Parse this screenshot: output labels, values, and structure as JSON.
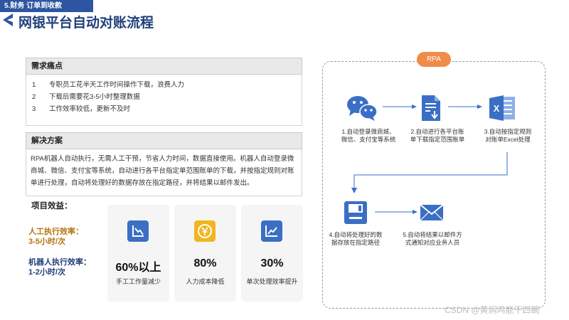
{
  "header": {
    "tag": "5.财务 订单到收款",
    "title": "网银平台自动对账流程"
  },
  "pain_points": {
    "heading": "需求痛点",
    "items": [
      {
        "num": "1",
        "text": "专职员工花半天工作时间操作下载，浪费人力"
      },
      {
        "num": "2",
        "text": "下载后需要花3-5小时整理数据"
      },
      {
        "num": "3",
        "text": "工作效率较低，更新不及时"
      }
    ]
  },
  "solution": {
    "heading": "解决方案",
    "text": "RPA机器人自动执行，无需人工干预，节省人力时间，数据直接使用。机器人自动登录微商城、微信、支付宝等系统，自动进行各平台指定单范围账单的下载，并按指定规则对账单进行处理，自动将处理好的数据存放在指定路径，并将结果以邮件发出。"
  },
  "results": {
    "title": "项目效益：",
    "manual_label": "人工执行效率：",
    "manual_value": "3-5小时/次",
    "robot_label": "机器人执行效率：",
    "robot_value": "1-2小时/次",
    "cards": [
      {
        "value": "60%以上",
        "caption": "手工工作量减少",
        "icon": "chart-down-icon",
        "color": "#3a6fc4"
      },
      {
        "value": "80%",
        "caption": "人力成本降低",
        "icon": "yen-coin-icon",
        "color": "#f2b51e"
      },
      {
        "value": "30%",
        "caption": "单次处理效率提升",
        "icon": "chart-up-icon",
        "color": "#3a6fc4"
      }
    ]
  },
  "flow": {
    "label": "RPA",
    "accent": "#f08c4a",
    "steps": [
      {
        "line1": "1.自动登录微商城、",
        "line2": "微信、支付宝等系统",
        "icon": "wechat-icon"
      },
      {
        "line1": "2.自动进行各平台账",
        "line2": "单下载指定范围账单",
        "icon": "document-download-icon"
      },
      {
        "line1": "3.自动按指定规则",
        "line2": "对账单Excel处理",
        "icon": "excel-icon"
      },
      {
        "line1": "4.自动将处理好的数",
        "line2": "据存放在指定路径",
        "icon": "save-disk-icon"
      },
      {
        "line1": "5.自动将结果以邮件方",
        "line2": "式通知对应业务人员",
        "icon": "mail-icon"
      }
    ]
  },
  "watermark": "CSDN @黄焖鸡能干四碗"
}
